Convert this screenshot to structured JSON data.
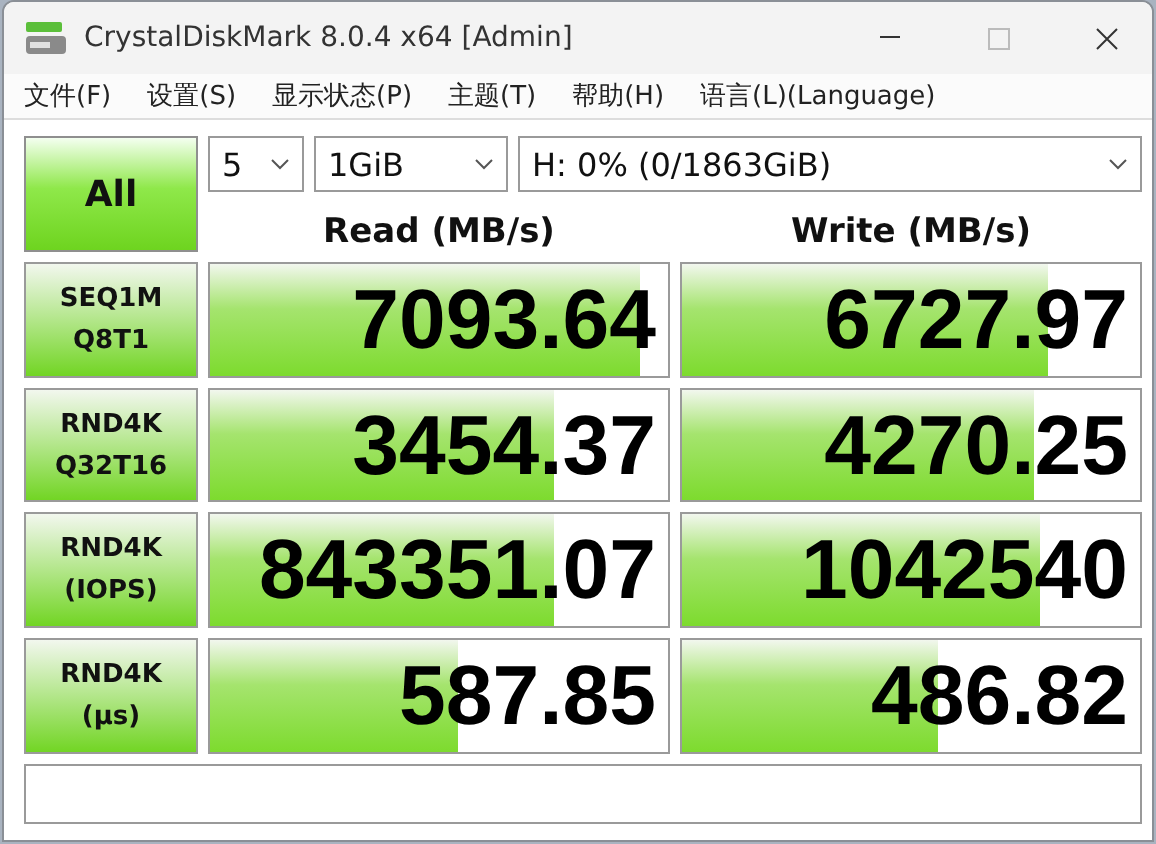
{
  "window": {
    "title": "CrystalDiskMark 8.0.4 x64 [Admin]"
  },
  "menu": [
    "文件(F)",
    "设置(S)",
    "显示状态(P)",
    "主题(T)",
    "帮助(H)",
    "语言(L)(Language)"
  ],
  "all_button": "All",
  "selectors": {
    "count": "5",
    "size": "1GiB",
    "drive": "H: 0% (0/1863GiB)"
  },
  "columns": [
    "Read (MB/s)",
    "Write (MB/s)"
  ],
  "tests": [
    {
      "label": [
        "SEQ1M",
        "Q8T1"
      ],
      "read": {
        "value": "7093.64",
        "level": 0.94
      },
      "write": {
        "value": "6727.97",
        "level": 0.8
      }
    },
    {
      "label": [
        "RND4K",
        "Q32T16"
      ],
      "read": {
        "value": "3454.37",
        "level": 0.75
      },
      "write": {
        "value": "4270.25",
        "level": 0.77
      }
    },
    {
      "label": [
        "RND4K",
        "(IOPS)"
      ],
      "read": {
        "value": "843351.07",
        "level": 0.75
      },
      "write": {
        "value": "1042540",
        "level": 0.78
      }
    },
    {
      "label": [
        "RND4K",
        "(μs)"
      ],
      "read": {
        "value": "587.85",
        "level": 0.54
      },
      "write": {
        "value": "486.82",
        "level": 0.56
      }
    }
  ]
}
